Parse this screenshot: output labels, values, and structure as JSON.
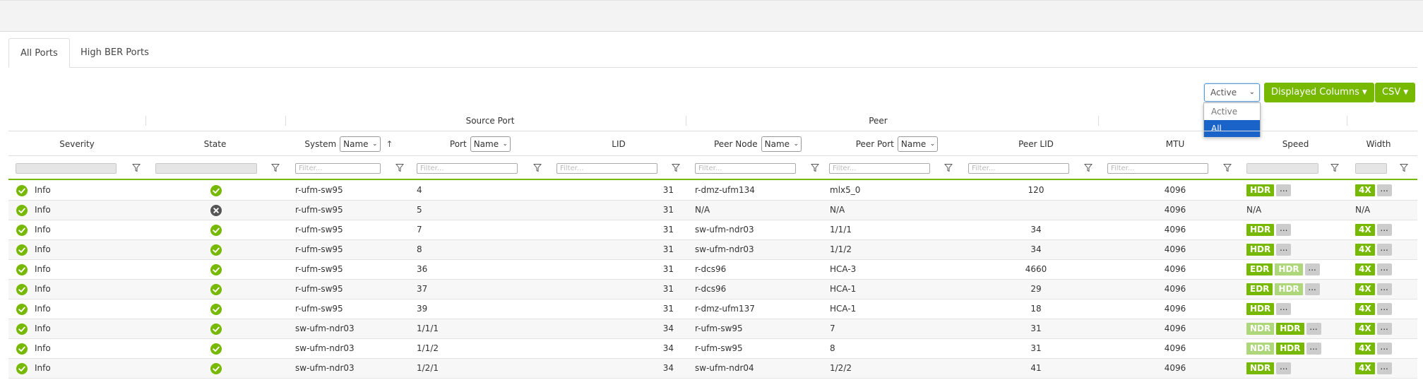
{
  "tabs": [
    {
      "label": "All Ports"
    },
    {
      "label": "High BER Ports"
    }
  ],
  "toolbar": {
    "filter_select": {
      "value": "Active",
      "options": [
        "Active",
        "All"
      ]
    },
    "displayed_columns_label": "Displayed Columns",
    "csv_label": "CSV"
  },
  "groups": {
    "source_port": "Source Port",
    "peer": "Peer"
  },
  "headers": {
    "severity": "Severity",
    "state": "State",
    "system": "System",
    "system_select": "Name",
    "port": "Port",
    "port_select": "Name",
    "lid": "LID",
    "peer_node": "Peer Node",
    "peer_node_select": "Name",
    "peer_port": "Peer Port",
    "peer_port_select": "Name",
    "peer_lid": "Peer LID",
    "mtu": "MTU",
    "speed": "Speed",
    "width": "Width"
  },
  "filter_placeholder": "Filter...",
  "colors": {
    "accent": "#76b900",
    "accent_light": "#add77a",
    "selected": "#1a63c9",
    "state_down": "#555555"
  },
  "rows": [
    {
      "severity": "Info",
      "state": "ok",
      "system": "r-ufm-sw95",
      "port": "4",
      "lid": "31",
      "peer_node": "r-dmz-ufm134",
      "peer_port": "mlx5_0",
      "peer_lid": "120",
      "mtu": "4096",
      "speed": [
        {
          "label": "HDR",
          "light": false
        }
      ],
      "speed_more": true,
      "width": [
        {
          "label": "4X"
        }
      ],
      "width_more": true
    },
    {
      "severity": "Info",
      "state": "down",
      "system": "r-ufm-sw95",
      "port": "5",
      "lid": "31",
      "peer_node": "N/A",
      "peer_port": "N/A",
      "peer_lid": "",
      "mtu": "4096",
      "speed_text": "N/A",
      "speed": [],
      "speed_more": false,
      "width_text": "N/A",
      "width": [],
      "width_more": false
    },
    {
      "severity": "Info",
      "state": "ok",
      "system": "r-ufm-sw95",
      "port": "7",
      "lid": "31",
      "peer_node": "sw-ufm-ndr03",
      "peer_port": "1/1/1",
      "peer_lid": "34",
      "mtu": "4096",
      "speed": [
        {
          "label": "HDR",
          "light": false
        }
      ],
      "speed_more": true,
      "width": [
        {
          "label": "4X"
        }
      ],
      "width_more": true
    },
    {
      "severity": "Info",
      "state": "ok",
      "system": "r-ufm-sw95",
      "port": "8",
      "lid": "31",
      "peer_node": "sw-ufm-ndr03",
      "peer_port": "1/1/2",
      "peer_lid": "34",
      "mtu": "4096",
      "speed": [
        {
          "label": "HDR",
          "light": false
        }
      ],
      "speed_more": true,
      "width": [
        {
          "label": "4X"
        }
      ],
      "width_more": true
    },
    {
      "severity": "Info",
      "state": "ok",
      "system": "r-ufm-sw95",
      "port": "36",
      "lid": "31",
      "peer_node": "r-dcs96",
      "peer_port": "HCA-3",
      "peer_lid": "4660",
      "mtu": "4096",
      "speed": [
        {
          "label": "EDR",
          "light": false
        },
        {
          "label": "HDR",
          "light": true
        }
      ],
      "speed_more": true,
      "width": [
        {
          "label": "4X"
        }
      ],
      "width_more": true
    },
    {
      "severity": "Info",
      "state": "ok",
      "system": "r-ufm-sw95",
      "port": "37",
      "lid": "31",
      "peer_node": "r-dcs96",
      "peer_port": "HCA-1",
      "peer_lid": "29",
      "mtu": "4096",
      "speed": [
        {
          "label": "EDR",
          "light": false
        },
        {
          "label": "HDR",
          "light": true
        }
      ],
      "speed_more": true,
      "width": [
        {
          "label": "4X"
        }
      ],
      "width_more": true
    },
    {
      "severity": "Info",
      "state": "ok",
      "system": "r-ufm-sw95",
      "port": "39",
      "lid": "31",
      "peer_node": "r-dmz-ufm137",
      "peer_port": "HCA-1",
      "peer_lid": "18",
      "mtu": "4096",
      "speed": [
        {
          "label": "HDR",
          "light": false
        }
      ],
      "speed_more": true,
      "width": [
        {
          "label": "4X"
        }
      ],
      "width_more": true
    },
    {
      "severity": "Info",
      "state": "ok",
      "system": "sw-ufm-ndr03",
      "port": "1/1/1",
      "lid": "34",
      "peer_node": "r-ufm-sw95",
      "peer_port": "7",
      "peer_lid": "31",
      "mtu": "4096",
      "speed": [
        {
          "label": "NDR",
          "light": true
        },
        {
          "label": "HDR",
          "light": false
        }
      ],
      "speed_more": true,
      "width": [
        {
          "label": "4X"
        }
      ],
      "width_more": true
    },
    {
      "severity": "Info",
      "state": "ok",
      "system": "sw-ufm-ndr03",
      "port": "1/1/2",
      "lid": "34",
      "peer_node": "r-ufm-sw95",
      "peer_port": "8",
      "peer_lid": "31",
      "mtu": "4096",
      "speed": [
        {
          "label": "NDR",
          "light": true
        },
        {
          "label": "HDR",
          "light": false
        }
      ],
      "speed_more": true,
      "width": [
        {
          "label": "4X"
        }
      ],
      "width_more": true
    },
    {
      "severity": "Info",
      "state": "ok",
      "system": "sw-ufm-ndr03",
      "port": "1/2/1",
      "lid": "34",
      "peer_node": "sw-ufm-ndr04",
      "peer_port": "1/2/2",
      "peer_lid": "41",
      "mtu": "4096",
      "speed": [
        {
          "label": "NDR",
          "light": false
        }
      ],
      "speed_more": true,
      "width": [
        {
          "label": "4X"
        }
      ],
      "width_more": true
    }
  ]
}
